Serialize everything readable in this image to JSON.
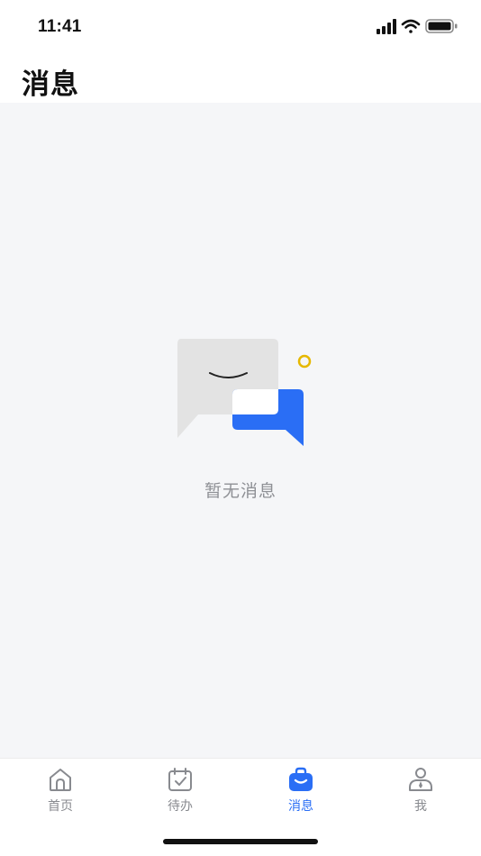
{
  "status_bar": {
    "time": "11:41"
  },
  "header": {
    "title": "消息"
  },
  "empty_state": {
    "message": "暂无消息",
    "illustration": "empty-messages-illustration"
  },
  "tab_bar": {
    "items": [
      {
        "label": "首页",
        "icon": "home-icon",
        "active": false
      },
      {
        "label": "待办",
        "icon": "calendar-check-icon",
        "active": false
      },
      {
        "label": "消息",
        "icon": "briefcase-icon",
        "active": true
      },
      {
        "label": "我",
        "icon": "person-icon",
        "active": false
      }
    ]
  },
  "colors": {
    "accent": "#2a6ef5",
    "inactive": "#888a8f",
    "background": "#f5f6f8",
    "illustration_gray": "#e3e3e3",
    "illustration_yellow": "#e6b800"
  }
}
